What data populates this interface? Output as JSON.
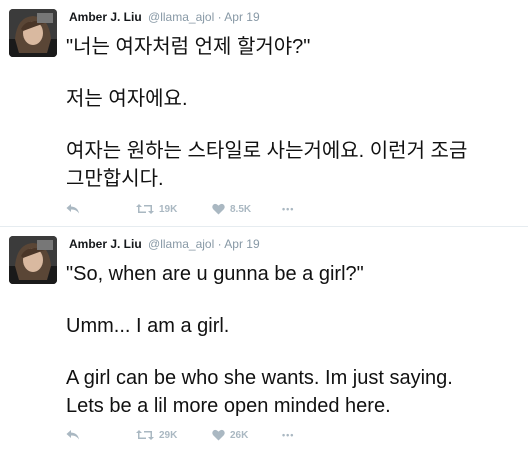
{
  "tweets": [
    {
      "author": {
        "name": "Amber J. Liu",
        "handle": "@llama_ajol"
      },
      "separator": "·",
      "date": "Apr 19",
      "lines": [
        "\"너는 여자처럼 언제 할거야?\"",
        "저는 여자에요.",
        "여자는 원하는 스타일로 사는거에요. 이런거 조금",
        "그만합시다."
      ],
      "retweets": "19K",
      "likes": "8.5K",
      "more": "•••"
    },
    {
      "author": {
        "name": "Amber J. Liu",
        "handle": "@llama_ajol"
      },
      "separator": "·",
      "date": "Apr 19",
      "lines": [
        "\"So, when are u gunna be a girl?\"",
        "Umm... I am a girl.",
        "A girl can be who she wants. Im just saying.",
        "Lets be a lil more open minded here."
      ],
      "retweets": "29K",
      "likes": "26K",
      "more": "•••"
    }
  ],
  "colors": {
    "name": "#14171a",
    "meta": "#8899a6",
    "action": "#aab8c2",
    "divider": "#e6ecf0"
  },
  "icons": [
    "reply-icon",
    "retweet-icon",
    "heart-icon",
    "more-icon"
  ]
}
